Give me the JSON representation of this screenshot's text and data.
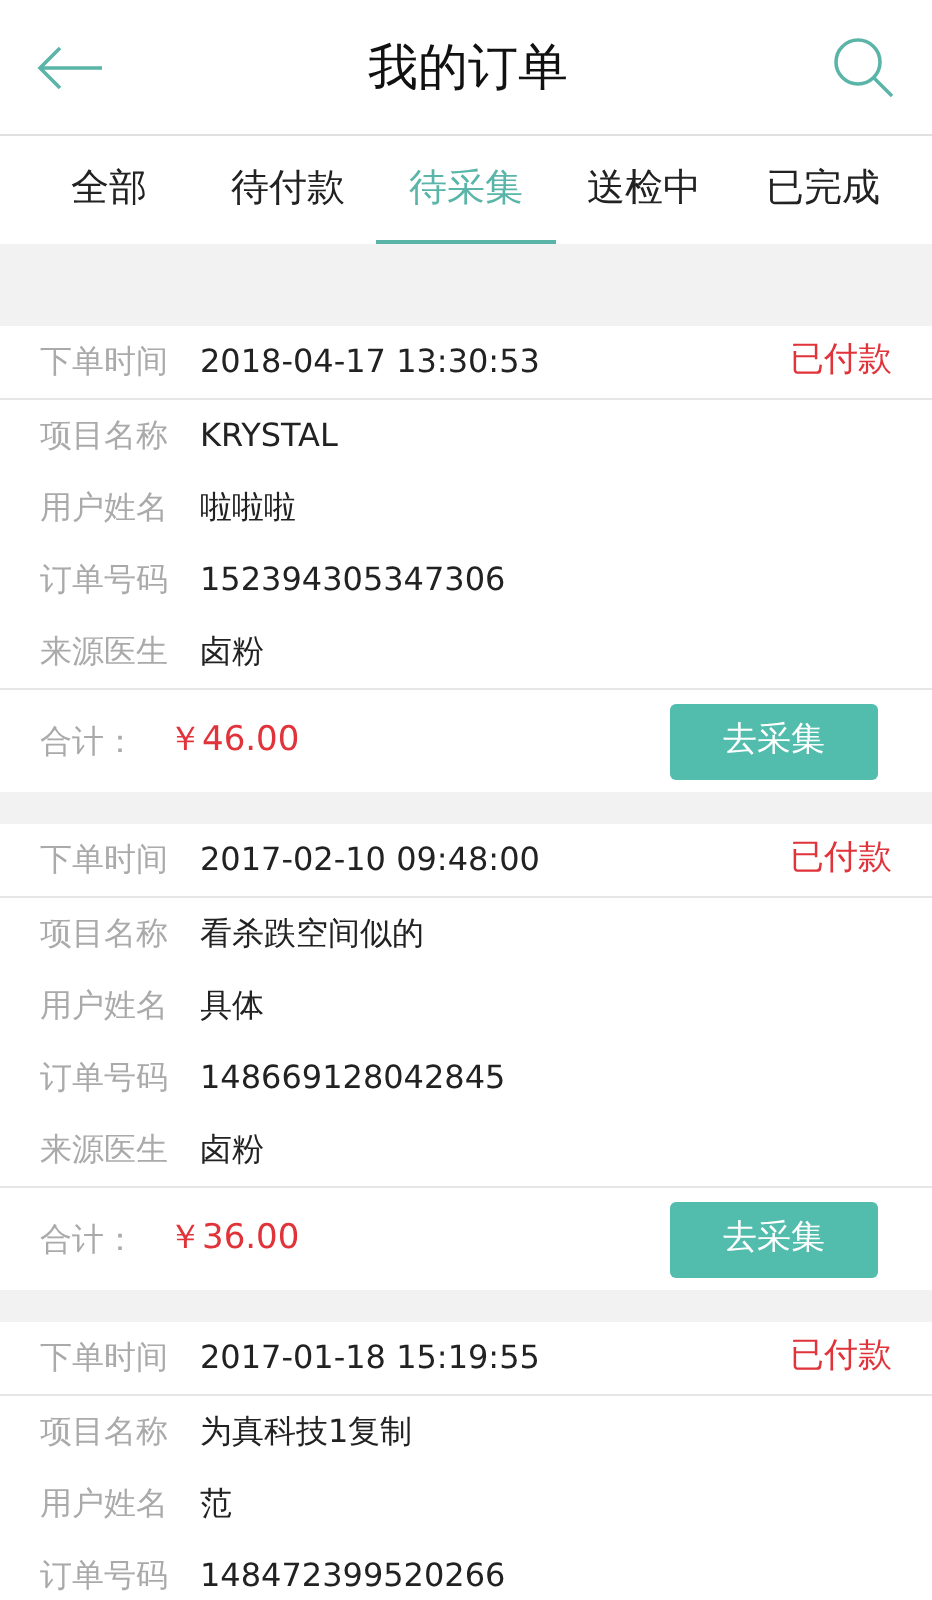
{
  "header": {
    "title": "我的订单"
  },
  "tabs": [
    {
      "label": "全部",
      "selected": false
    },
    {
      "label": "待付款",
      "selected": false
    },
    {
      "label": "待采集",
      "selected": true
    },
    {
      "label": "送检中",
      "selected": false
    },
    {
      "label": "已完成",
      "selected": false
    }
  ],
  "orders": [
    {
      "time_label": "下单时间",
      "time": "2018-04-17 13:30:53",
      "status": "已付款",
      "fields": [
        {
          "label": "项目名称",
          "value": "KRYSTAL"
        },
        {
          "label": "用户姓名",
          "value": "啦啦啦"
        },
        {
          "label": "订单号码",
          "value": "152394305347306"
        },
        {
          "label": "来源医生",
          "value": "卤粉"
        }
      ],
      "total_label": "合计：",
      "total": "￥46.00",
      "action": "去采集"
    },
    {
      "time_label": "下单时间",
      "time": "2017-02-10 09:48:00",
      "status": "已付款",
      "fields": [
        {
          "label": "项目名称",
          "value": "看杀跌空间似的"
        },
        {
          "label": "用户姓名",
          "value": "具体"
        },
        {
          "label": "订单号码",
          "value": "148669128042845"
        },
        {
          "label": "来源医生",
          "value": "卤粉"
        }
      ],
      "total_label": "合计：",
      "total": "￥36.00",
      "action": "去采集"
    },
    {
      "time_label": "下单时间",
      "time": "2017-01-18 15:19:55",
      "status": "已付款",
      "fields": [
        {
          "label": "项目名称",
          "value": "为真科技1复制"
        },
        {
          "label": "用户姓名",
          "value": "范"
        },
        {
          "label": "订单号码",
          "value": "148472399520266"
        }
      ]
    }
  ]
}
